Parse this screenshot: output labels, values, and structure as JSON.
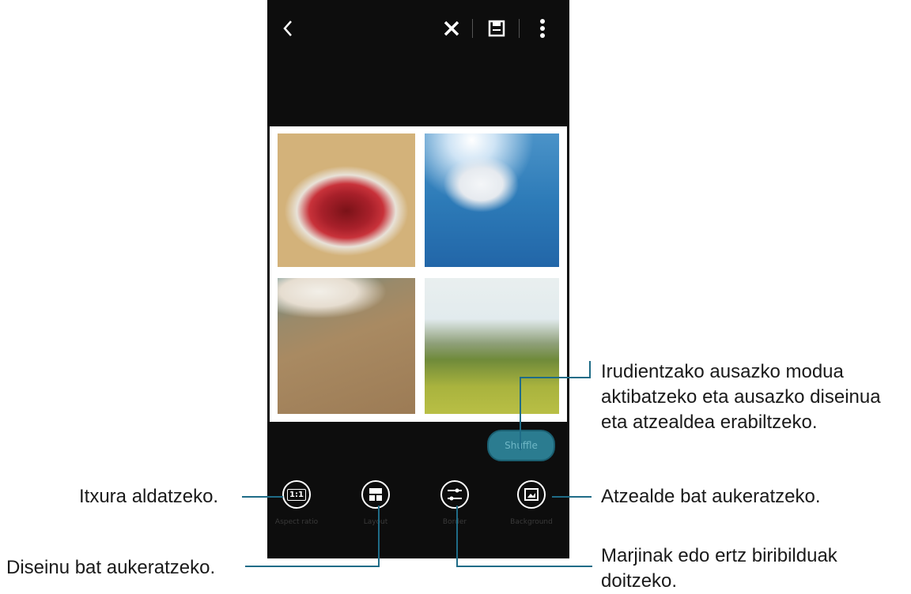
{
  "toolbar": {
    "back_icon": "chevron-left-icon",
    "close_icon": "close-icon",
    "save_icon": "save-icon",
    "more_icon": "more-vertical-icon"
  },
  "shuffle_button": {
    "label": "Shuffle"
  },
  "tools": [
    {
      "id": "aspect-ratio",
      "icon_text": "1:1",
      "label": "Aspect ratio"
    },
    {
      "id": "layout",
      "icon": "layout-icon",
      "label": "Layout"
    },
    {
      "id": "border",
      "icon": "border-sliders-icon",
      "label": "Border"
    },
    {
      "id": "background",
      "icon": "background-image-icon",
      "label": "Background"
    }
  ],
  "callouts": {
    "shuffle": [
      "Irudientzako ausazko modua",
      "aktibatzeko eta ausazko diseinua",
      "eta atzealdea erabiltzeko."
    ],
    "aspect": "Itxura aldatzeko.",
    "background": "Atzealde bat aukeratzeko.",
    "layout": "Diseinu bat aukeratzeko.",
    "border": [
      "Marjinak edo ertz biribilduak",
      "doitzeko."
    ]
  },
  "colors": {
    "accent": "#1f6c87",
    "screen_bg": "#0d0d0d",
    "shuffle_bg": "#2b7c90"
  }
}
